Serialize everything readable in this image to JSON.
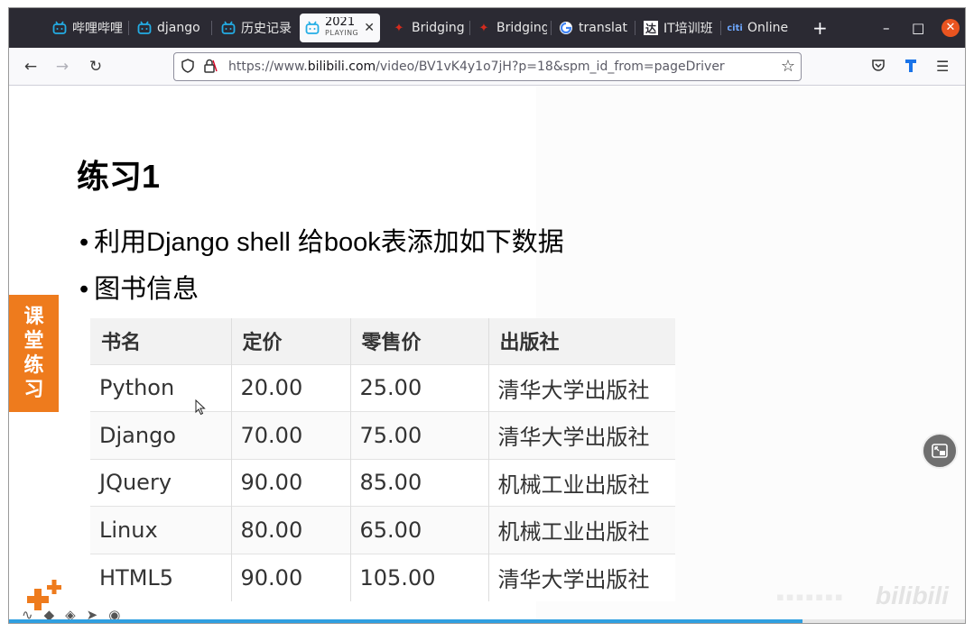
{
  "tabs": [
    {
      "label": "哔哩哔哩",
      "icon": "bilibili-icon",
      "active": false
    },
    {
      "label": "django",
      "icon": "bilibili-icon",
      "active": false
    },
    {
      "label": "历史记录",
      "icon": "bilibili-icon",
      "active": false
    },
    {
      "label": "2021",
      "sublabel": "PLAYING",
      "icon": "bilibili-icon",
      "active": true
    },
    {
      "label": "Bridging",
      "icon": "maple-leaf-icon",
      "active": false
    },
    {
      "label": "Bridging",
      "icon": "maple-leaf-icon",
      "active": false
    },
    {
      "label": "translat",
      "icon": "google-icon",
      "active": false
    },
    {
      "label": "IT培训班",
      "icon": "da-icon",
      "active": false
    },
    {
      "label": "Online",
      "icon": "citi-icon",
      "active": false
    }
  ],
  "toolbar": {
    "url_prefix": "https://www.",
    "url_domain": "bilibili.com",
    "url_path": "/video/BV1vK4y1o7jH?p=18&spm_id_from=pageDriver",
    "new_tab": "+",
    "minimize": "–",
    "maximize": "□",
    "close": "✕"
  },
  "slide": {
    "title": "练习1",
    "bullet1": "利用Django shell 给book表添加如下数据",
    "bullet2": "图书信息",
    "side_tag": [
      "课",
      "堂",
      "练",
      "习"
    ]
  },
  "table": {
    "headers": [
      "书名",
      "定价",
      "零售价",
      "出版社"
    ],
    "rows": [
      [
        "Python",
        "20.00",
        "25.00",
        "清华大学出版社"
      ],
      [
        "Django",
        "70.00",
        "75.00",
        "清华大学出版社"
      ],
      [
        "JQuery",
        "90.00",
        "85.00",
        "机械工业出版社"
      ],
      [
        "Linux",
        "80.00",
        "65.00",
        "机械工业出版社"
      ],
      [
        "HTML5",
        "90.00",
        "105.00",
        "清华大学出版社"
      ]
    ]
  },
  "watermark": "bilibili",
  "colors": {
    "accent_orange": "#ee7b1d",
    "progress_blue": "#2f9fe0",
    "tabbar": "#2b2a33"
  },
  "video": {
    "progress_fraction": 0.83
  }
}
